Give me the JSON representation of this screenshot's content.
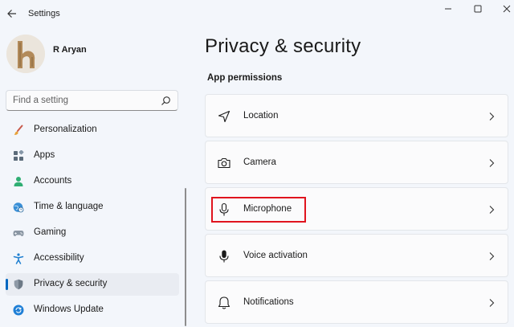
{
  "window": {
    "title": "Settings"
  },
  "profile": {
    "name": "R Aryan",
    "avatar_letter": "h"
  },
  "search": {
    "placeholder": "Find a setting"
  },
  "sidebar": {
    "items": [
      {
        "label": "Personalization",
        "icon": "brush-icon",
        "active": false
      },
      {
        "label": "Apps",
        "icon": "apps-icon",
        "active": false
      },
      {
        "label": "Accounts",
        "icon": "person-icon",
        "active": false
      },
      {
        "label": "Time & language",
        "icon": "globe-clock-icon",
        "active": false
      },
      {
        "label": "Gaming",
        "icon": "gamepad-icon",
        "active": false
      },
      {
        "label": "Accessibility",
        "icon": "accessibility-icon",
        "active": false
      },
      {
        "label": "Privacy & security",
        "icon": "shield-icon",
        "active": true
      },
      {
        "label": "Windows Update",
        "icon": "update-icon",
        "active": false
      }
    ]
  },
  "main": {
    "title": "Privacy & security",
    "section_title": "App permissions",
    "permissions": [
      {
        "label": "Location",
        "icon": "location-arrow-icon"
      },
      {
        "label": "Camera",
        "icon": "camera-icon"
      },
      {
        "label": "Microphone",
        "icon": "microphone-icon",
        "highlighted": true
      },
      {
        "label": "Voice activation",
        "icon": "voice-mic-icon"
      },
      {
        "label": "Notifications",
        "icon": "bell-icon"
      }
    ]
  },
  "colors": {
    "accent": "#0067c0",
    "highlight": "#e0141e",
    "background": "#f3f6fb",
    "card": "#fbfbfc"
  }
}
